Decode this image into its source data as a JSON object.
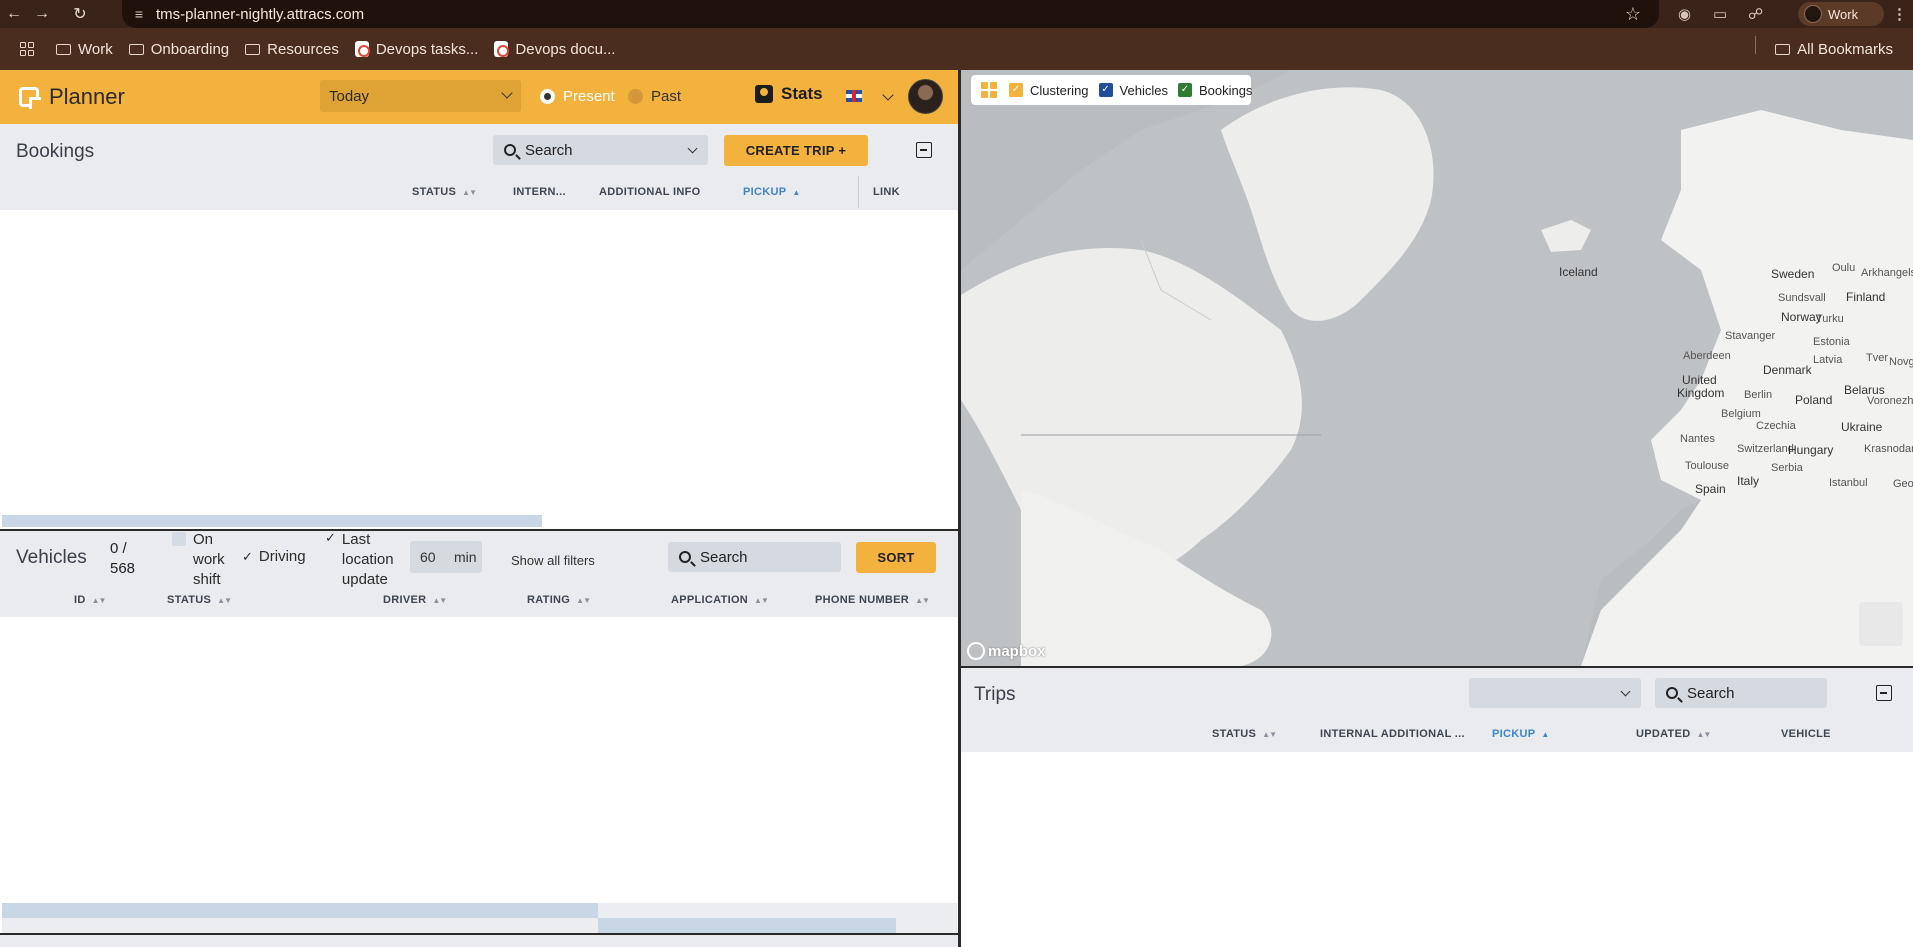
{
  "browser": {
    "url": "tms-planner-nightly.attracs.com",
    "profile": "Work",
    "bookmarks": [
      "Work",
      "Onboarding",
      "Resources",
      "Devops tasks...",
      "Devops docu..."
    ],
    "all_bookmarks": "All Bookmarks"
  },
  "header": {
    "app_name": "Planner",
    "date_filter": "Today",
    "radio_present": "Present",
    "radio_past": "Past",
    "stats_label": "Stats"
  },
  "bookings": {
    "title": "Bookings",
    "search_placeholder": "Search",
    "create_button": "CREATE TRIP +",
    "columns": [
      "STATUS",
      "INTERN...",
      "ADDITIONAL INFO",
      "PICKUP",
      "LINK"
    ]
  },
  "vehicles": {
    "title": "Vehicles",
    "count": "0 /",
    "total": "568",
    "filter_on_work_shift_1": "On",
    "filter_on_work_shift_2": "work",
    "filter_on_work_shift_3": "shift",
    "filter_driving": "Driving",
    "filter_last_location_1": "Last",
    "filter_last_location_2": "location",
    "filter_last_location_3": "update",
    "minutes_value": "60",
    "minutes_unit": "min",
    "show_all_filters": "Show all filters",
    "search_placeholder": "Search",
    "sort_button": "SORT",
    "columns": [
      "ID",
      "STATUS",
      "DRIVER",
      "RATING",
      "APPLICATION",
      "PHONE NUMBER"
    ]
  },
  "map": {
    "layers": [
      "Clustering",
      "Vehicles",
      "Bookings"
    ],
    "layer_colors": [
      "#f3b13d",
      "#1f4e9a",
      "#2e7d32"
    ],
    "labels": [
      "Iceland",
      "Sweden",
      "Finland",
      "Norway",
      "Oulu",
      "Arkhangelsk",
      "Sundsvall",
      "Turku",
      "Stavanger",
      "Estonia",
      "Aberdeen",
      "Denmark",
      "Latvia",
      "Tver",
      "Novgorod",
      "United",
      "Kingdom",
      "Berlin",
      "Poland",
      "Belarus",
      "Voronezh",
      "Belgium",
      "Czechia",
      "Ukraine",
      "Nantes",
      "Switzerland",
      "Hungary",
      "Krasnodar",
      "Toulouse",
      "Serbia",
      "Istanbul",
      "Italy",
      "Spain",
      "Georgia"
    ],
    "attribution": "mapbox"
  },
  "trips": {
    "title": "Trips",
    "search_placeholder": "Search",
    "columns": [
      "STATUS",
      "INTERNAL ADDITIONAL ...",
      "PICKUP",
      "UPDATED",
      "VEHICLE"
    ]
  }
}
